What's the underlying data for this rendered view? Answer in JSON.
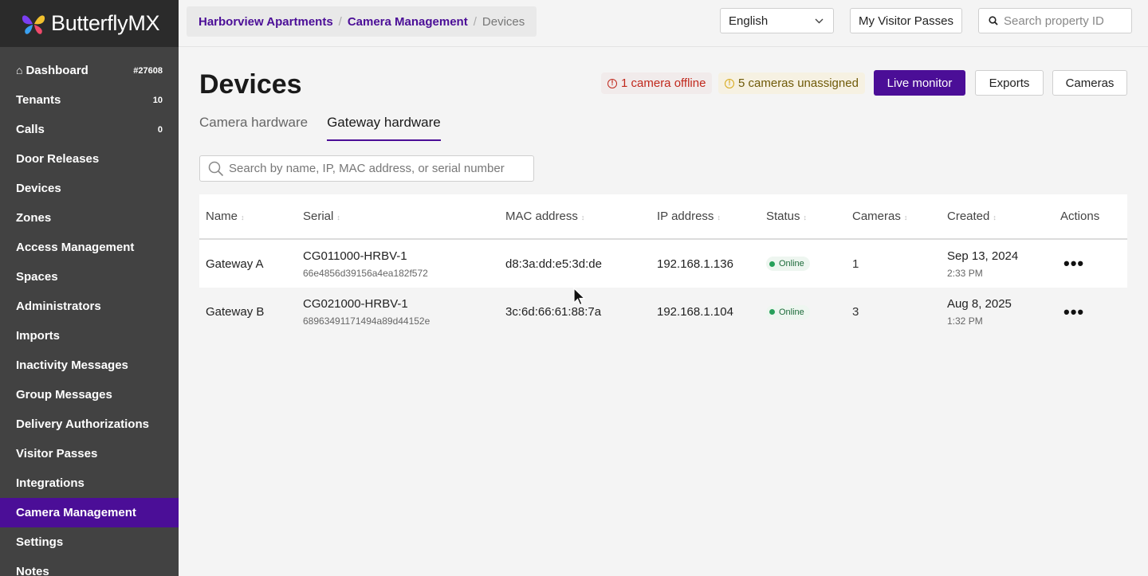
{
  "app": {
    "name": "ButterflyMX"
  },
  "sidebar": {
    "items": [
      {
        "label": "Dashboard",
        "badge": "#27608",
        "icon": "home-icon"
      },
      {
        "label": "Tenants",
        "badge": "10"
      },
      {
        "label": "Calls",
        "badge": "0"
      },
      {
        "label": "Door Releases",
        "badge": ""
      },
      {
        "label": "Devices",
        "badge": ""
      },
      {
        "label": "Zones",
        "badge": ""
      },
      {
        "label": "Access Management",
        "badge": ""
      },
      {
        "label": "Spaces",
        "badge": ""
      },
      {
        "label": "Administrators",
        "badge": ""
      },
      {
        "label": "Imports",
        "badge": ""
      },
      {
        "label": "Inactivity Messages",
        "badge": ""
      },
      {
        "label": "Group Messages",
        "badge": ""
      },
      {
        "label": "Delivery Authorizations",
        "badge": ""
      },
      {
        "label": "Visitor Passes",
        "badge": ""
      },
      {
        "label": "Integrations",
        "badge": ""
      },
      {
        "label": "Camera Management",
        "badge": "",
        "active": true
      },
      {
        "label": "Settings",
        "badge": ""
      },
      {
        "label": "Notes",
        "badge": ""
      }
    ]
  },
  "header": {
    "breadcrumb": [
      "Harborview Apartments",
      "Camera Management",
      "Devices"
    ],
    "language": "English",
    "visitor_passes_label": "My Visitor Passes",
    "property_search_placeholder": "Search property ID"
  },
  "page": {
    "title": "Devices",
    "alerts": {
      "offline": "1 camera offline",
      "unassigned": "5 cameras unassigned"
    },
    "buttons": {
      "live_monitor": "Live monitor",
      "exports": "Exports",
      "cameras": "Cameras"
    },
    "tabs": [
      {
        "label": "Camera hardware",
        "active": false
      },
      {
        "label": "Gateway hardware",
        "active": true
      }
    ],
    "search_placeholder": "Search by name, IP, MAC address, or serial number"
  },
  "table": {
    "columns": [
      "Name",
      "Serial",
      "MAC address",
      "IP address",
      "Status",
      "Cameras",
      "Created",
      "Actions"
    ],
    "rows": [
      {
        "name": "Gateway A",
        "serial": "CG011000-HRBV-1",
        "serial_sub": "66e4856d39156a4ea182f572",
        "mac": "d8:3a:dd:e5:3d:de",
        "ip": "192.168.1.136",
        "status": "Online",
        "cameras": "1",
        "created_date": "Sep 13, 2024",
        "created_time": "2:33 PM",
        "actions": "•••"
      },
      {
        "name": "Gateway B",
        "serial": "CG021000-HRBV-1",
        "serial_sub": "68963491171494a89d44152e",
        "mac": "3c:6d:66:61:88:7a",
        "ip": "192.168.1.104",
        "status": "Online",
        "cameras": "3",
        "created_date": "Aug 8, 2025",
        "created_time": "1:32 PM",
        "actions": "•••"
      }
    ]
  },
  "colors": {
    "brand_purple": "#4b0e97",
    "sidebar_bg": "#424242",
    "offline_red": "#c0281c",
    "warning_yellow": "#d7a91a",
    "online_green": "#27a05a"
  }
}
